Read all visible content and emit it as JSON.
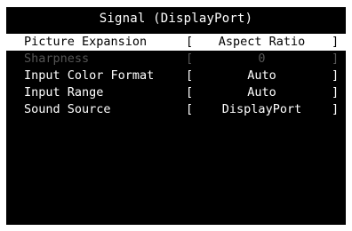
{
  "osd": {
    "title": "Signal (DisplayPort)",
    "items": [
      {
        "label": "Picture Expansion",
        "value": "Aspect Ratio",
        "open": "[",
        "close": "]",
        "state": "selected"
      },
      {
        "label": "Sharpness",
        "value": "0",
        "open": "[",
        "close": "]",
        "state": "disabled"
      },
      {
        "label": "Input Color Format",
        "value": "Auto",
        "open": "[",
        "close": "]",
        "state": "normal"
      },
      {
        "label": "Input Range",
        "value": "Auto",
        "open": "[",
        "close": "]",
        "state": "normal"
      },
      {
        "label": "Sound Source",
        "value": "DisplayPort",
        "open": "[",
        "close": "]",
        "state": "normal"
      }
    ]
  },
  "colors": {
    "background": "#000000",
    "text": "#ffffff",
    "selected_background": "#ffffff",
    "selected_text": "#000000",
    "disabled_text": "#555555"
  }
}
